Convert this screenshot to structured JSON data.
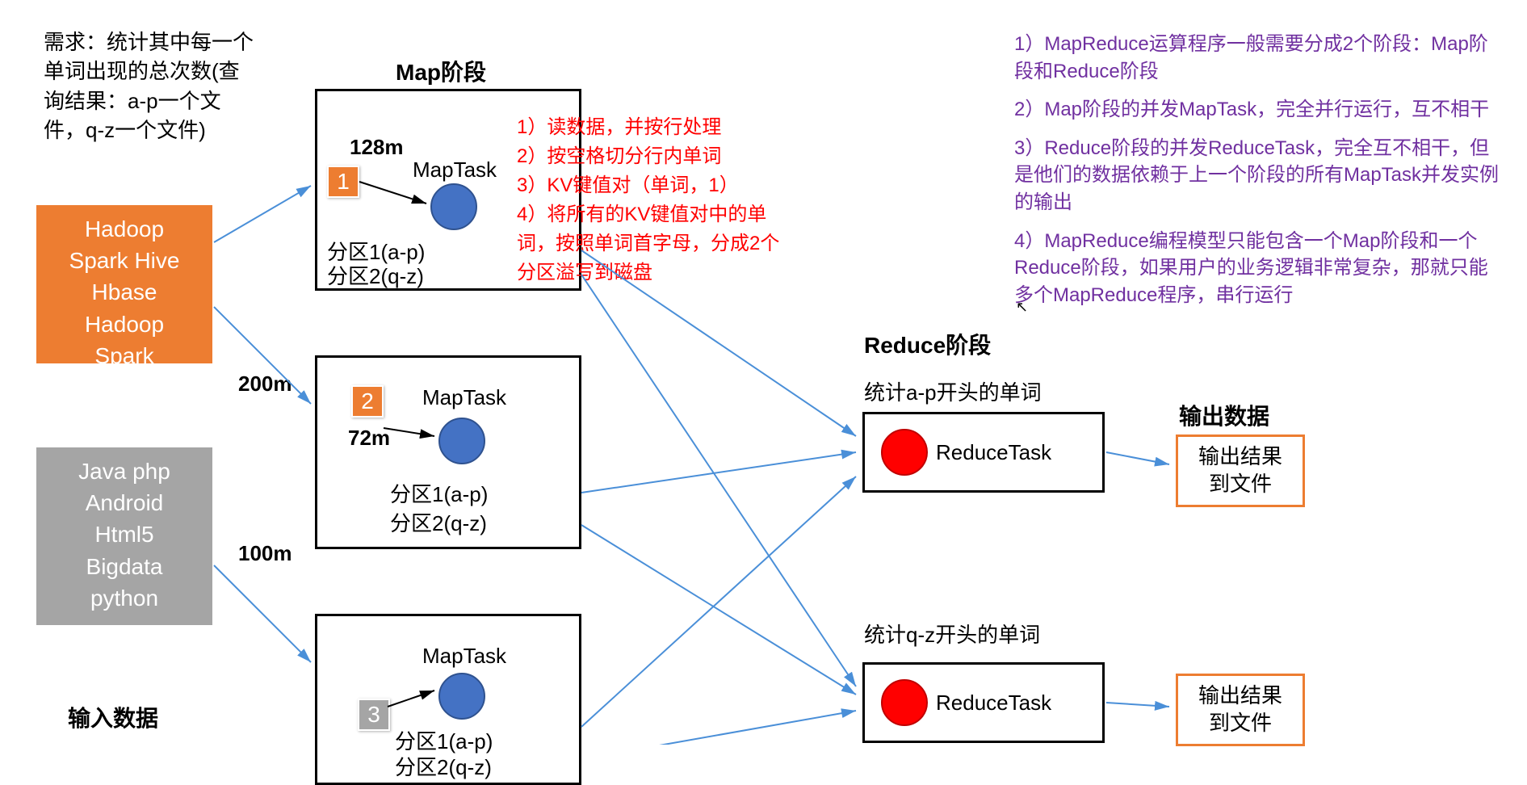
{
  "requirement": "需求：统计其中每一个单词出现的总次数(查询结果：a-p一个文件，q-z一个文件)",
  "input_label": "输入数据",
  "input_blocks": {
    "file1": "Hadoop\nSpark Hive\nHbase\nHadoop\nSpark\n…",
    "file2": "Java php\nAndroid\nHtml5\nBigdata\npython\n…"
  },
  "map_section_title": "Map阶段",
  "sizes": {
    "s128": "128m",
    "s200": "200m",
    "s72": "72m",
    "s100": "100m"
  },
  "maptask_label": "MapTask",
  "partitions": {
    "p1": "分区1(a-p)",
    "p2": "分区2(q-z)"
  },
  "badges": {
    "b1": "1",
    "b2": "2",
    "b3": "3"
  },
  "map_steps": {
    "s1": "1）读数据，并按行处理",
    "s2": "2）按空格切分行内单词",
    "s3": "3）KV键值对（单词，1）",
    "s4": "4）将所有的KV键值对中的单词，按照单词首字母，分成2个分区溢写到磁盘"
  },
  "reduce_section_title": "Reduce阶段",
  "reduce_labels": {
    "ap": "统计a-p开头的单词",
    "qz": "统计q-z开头的单词"
  },
  "reducetask_label": "ReduceTask",
  "output_section_title": "输出数据",
  "output_text": "输出结果\n到文件",
  "notes": {
    "n1": "1）MapReduce运算程序一般需要分成2个阶段：Map阶段和Reduce阶段",
    "n2": "2）Map阶段的并发MapTask，完全并行运行，互不相干",
    "n3": "3）Reduce阶段的并发ReduceTask，完全互不相干，但是他们的数据依赖于上一个阶段的所有MapTask并发实例的输出",
    "n4": "4）MapReduce编程模型只能包含一个Map阶段和一个Reduce阶段，如果用户的业务逻辑非常复杂，那就只能多个MapReduce程序，串行运行"
  }
}
